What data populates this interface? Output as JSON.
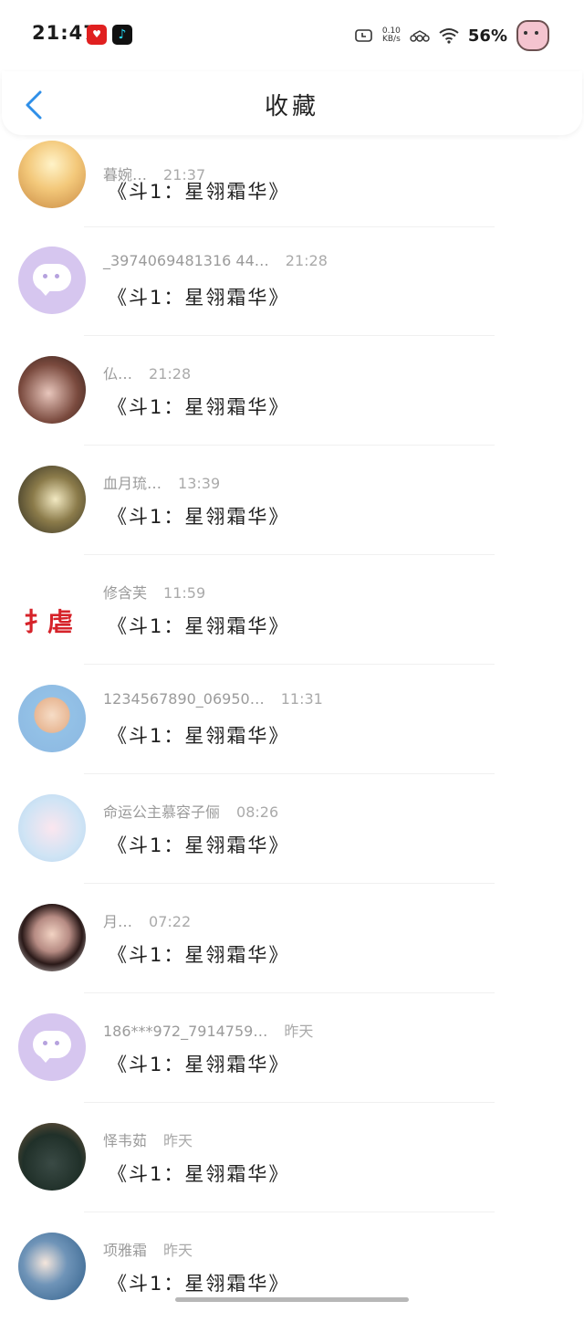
{
  "status_bar": {
    "time": "21:47",
    "net_speed_value": "0.10",
    "net_speed_unit": "KB/s",
    "battery": "56%"
  },
  "header": {
    "title": "收藏"
  },
  "items": [
    {
      "name": "暮婉…",
      "time": "21:37",
      "content": "《斗1：星翎霜华》"
    },
    {
      "name": "_3974069481316 44…",
      "time": "21:28",
      "content": "《斗1：星翎霜华》"
    },
    {
      "name": "仏…",
      "time": "21:28",
      "content": "《斗1：星翎霜华》"
    },
    {
      "name": "血月琉…",
      "time": "13:39",
      "content": "《斗1：星翎霜华》"
    },
    {
      "name": "修含芙",
      "time": "11:59",
      "content": "《斗1：星翎霜华》"
    },
    {
      "name": "1234567890_06950…",
      "time": "11:31",
      "content": "《斗1：星翎霜华》"
    },
    {
      "name": "命运公主慕容子俪",
      "time": "08:26",
      "content": "《斗1：星翎霜华》"
    },
    {
      "name": "月…",
      "time": "07:22",
      "content": "《斗1：星翎霜华》"
    },
    {
      "name": "186***972_7914759…",
      "time": "昨天",
      "content": "《斗1：星翎霜华》"
    },
    {
      "name": "怿韦茹",
      "time": "昨天",
      "content": "《斗1：星翎霜华》"
    },
    {
      "name": "项雅霜",
      "time": "昨天",
      "content": "《斗1：星翎霜华》"
    }
  ],
  "colors": {
    "accent": "#2f8fe8",
    "muted": "#9b9b9b",
    "bubble_avatar": "#d6c6ef"
  },
  "icons": {
    "back": "chevron-left-icon",
    "wifi": "wifi-icon",
    "clock": "alarm-icon"
  }
}
